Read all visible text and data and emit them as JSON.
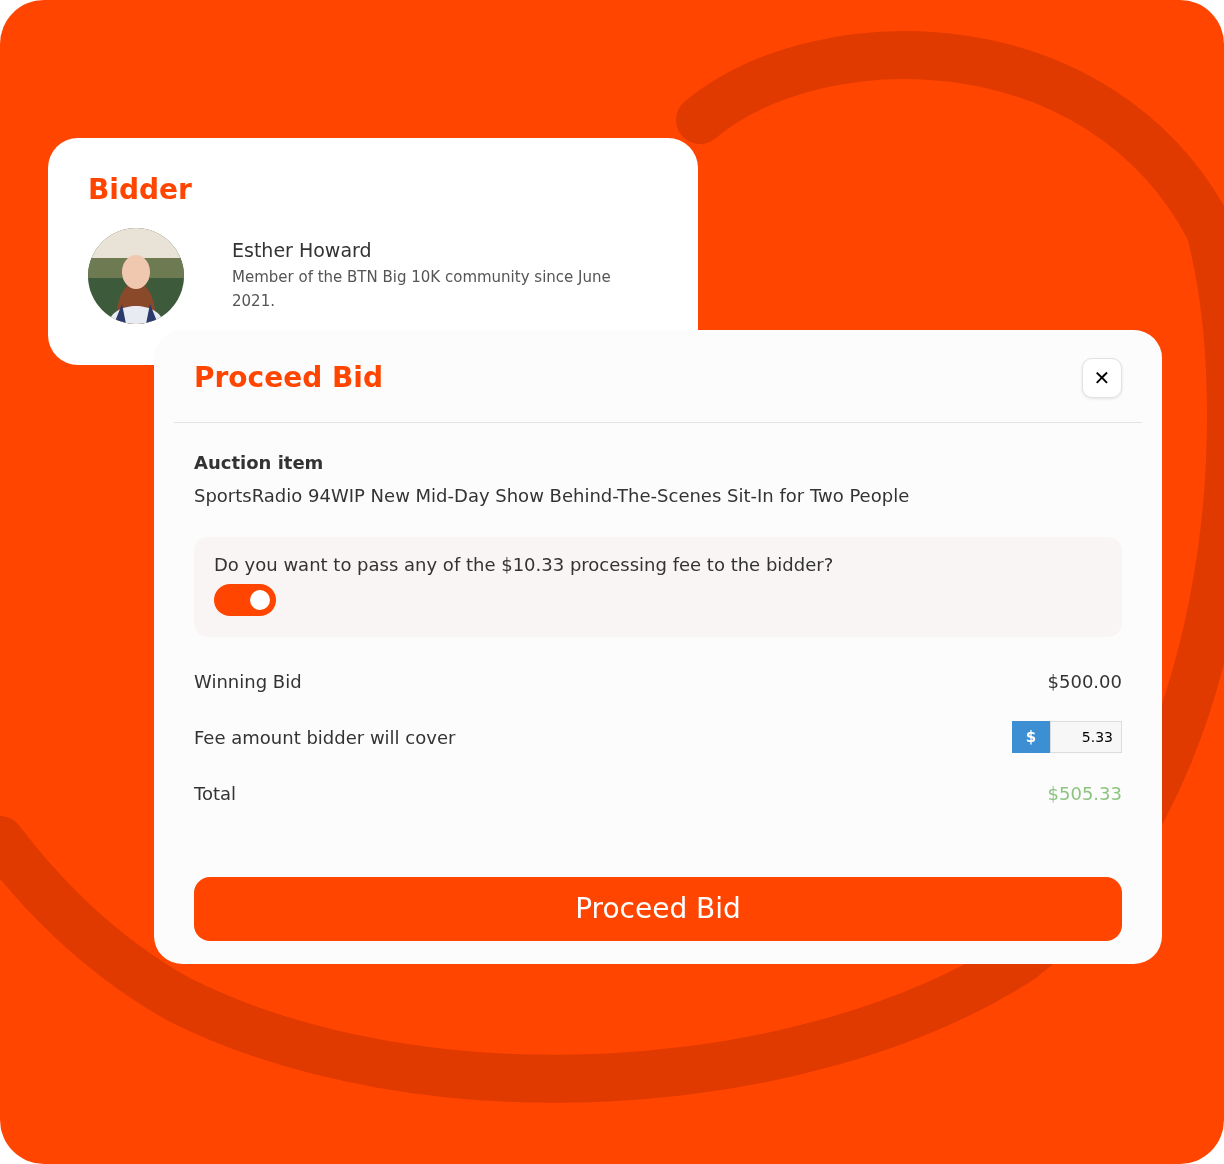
{
  "bidder_card": {
    "title": "Bidder",
    "name": "Esther Howard",
    "description": "Member of the BTN Big 10K community since June 2021."
  },
  "modal": {
    "title": "Proceed Bid",
    "close_label": "✕",
    "auction_item": {
      "label": "Auction item",
      "value": "SportsRadio 94WIP New Mid-Day Show Behind-The-Scenes Sit-In for Two People"
    },
    "fee_question": {
      "text": "Do you want to pass any of the $10.33 processing fee to the bidder?",
      "on": true
    },
    "rows": [
      {
        "kind": "text",
        "label": "Winning Bid",
        "value": "$500.00"
      },
      {
        "kind": "input",
        "label": "Fee amount bidder will cover",
        "prefix": "$",
        "value": "5.33"
      },
      {
        "kind": "total",
        "label": "Total",
        "value": "$505.33"
      }
    ],
    "button": "Proceed Bid"
  }
}
